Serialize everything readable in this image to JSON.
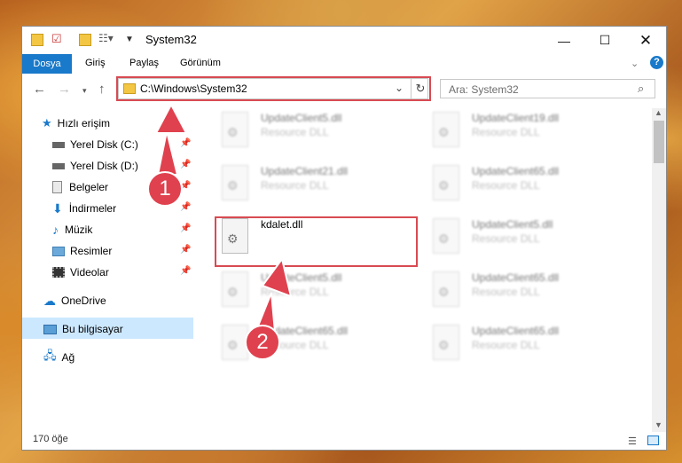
{
  "window": {
    "title": "System32"
  },
  "ribbon": {
    "tabs": [
      "Dosya",
      "Giriş",
      "Paylaş",
      "Görünüm"
    ]
  },
  "address": {
    "path": "C:\\Windows\\System32"
  },
  "search": {
    "placeholder": "Ara: System32"
  },
  "nav": {
    "quick_access": "Hızlı erişim",
    "items": [
      "Yerel Disk (C:)",
      "Yerel Disk (D:)",
      "Belgeler",
      "İndirmeler",
      "Müzik",
      "Resimler",
      "Videolar"
    ],
    "onedrive": "OneDrive",
    "this_pc": "Bu bilgisayar",
    "network": "Ağ"
  },
  "files": {
    "left": [
      {
        "name": "UpdateClient5.dll",
        "desc": "Resource DLL"
      },
      {
        "name": "UpdateClient21.dll",
        "desc": "Resource DLL"
      },
      {
        "name": "kdalet.dll",
        "desc": ""
      },
      {
        "name": "UpdateClient5.dll",
        "desc": "Resource DLL"
      },
      {
        "name": "UpdateClient65.dll",
        "desc": "Resource DLL"
      }
    ],
    "right": [
      {
        "name": "UpdateClient19.dll",
        "desc": "Resource DLL"
      },
      {
        "name": "UpdateClient65.dll",
        "desc": "Resource DLL"
      },
      {
        "name": "UpdateClient5.dll",
        "desc": "Resource DLL"
      },
      {
        "name": "UpdateClient65.dll",
        "desc": "Resource DLL"
      },
      {
        "name": "UpdateClient65.dll",
        "desc": "Resource DLL"
      }
    ]
  },
  "status": {
    "count": "170 öğe"
  },
  "annotations": {
    "one": "1",
    "two": "2"
  },
  "colors": {
    "accent": "#1979ca",
    "highlight": "#d84a52",
    "selected": "#cce8ff"
  }
}
